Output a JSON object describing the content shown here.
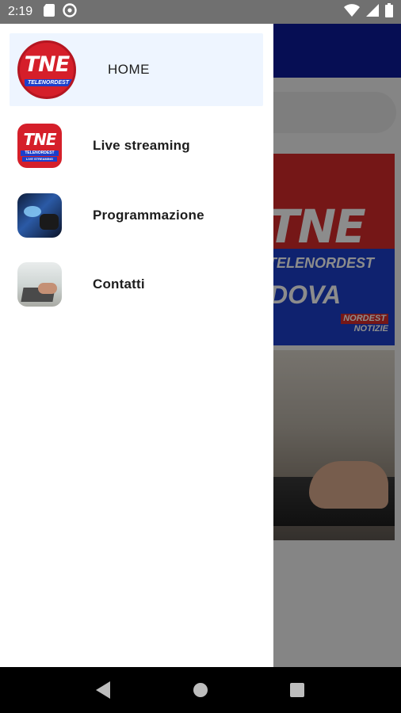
{
  "status_bar": {
    "time": "2:19",
    "icons": [
      "sd-card-icon",
      "sync-icon",
      "wifi-icon",
      "signal-icon",
      "battery-icon"
    ]
  },
  "drawer": {
    "items": [
      {
        "label": "HOME",
        "icon": "tne-logo-icon",
        "active": true
      },
      {
        "label": "Live streaming",
        "icon": "tne-live-streaming-icon",
        "active": false
      },
      {
        "label": "Programmazione",
        "icon": "gamepad-icon",
        "active": false
      },
      {
        "label": "Contatti",
        "icon": "laptop-contact-icon",
        "active": false
      }
    ]
  },
  "logo": {
    "main": "TNE",
    "sub": "TELENORDEST",
    "live_sub": "LIVE STREAMING"
  },
  "background": {
    "hero_brand": "TNE",
    "hero_tag": "TELENORDEST",
    "hero_city": "DOVA",
    "hero_badge_1": "NORDEST",
    "hero_badge_2": "NOTIZIE"
  },
  "colors": {
    "appbar": "#0b1a9a",
    "brand_red": "#d51f2a",
    "brand_blue": "#1c3fcb",
    "active_item_bg": "#eef5ff"
  }
}
